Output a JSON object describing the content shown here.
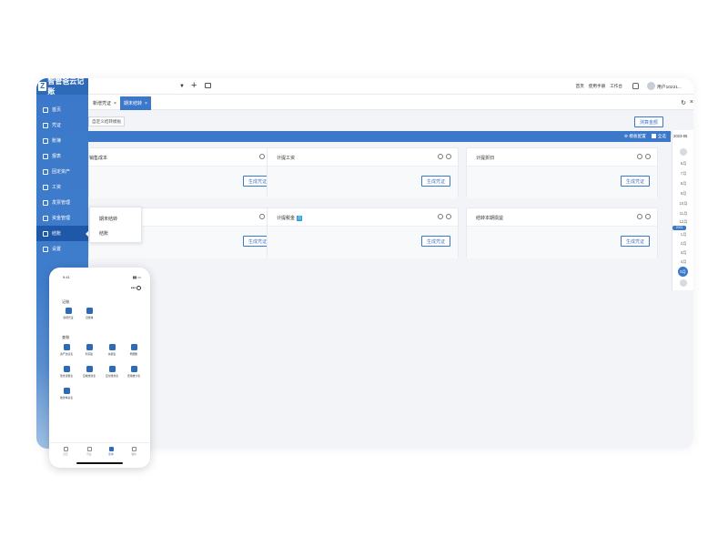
{
  "sidebar": {
    "logo_text": "智管爸云记账",
    "items": [
      {
        "label": "首页"
      },
      {
        "label": "凭证"
      },
      {
        "label": "账簿"
      },
      {
        "label": "报表"
      },
      {
        "label": "固定资产"
      },
      {
        "label": "工资"
      },
      {
        "label": "发票管理"
      },
      {
        "label": "资金管理"
      },
      {
        "label": "结账"
      },
      {
        "label": "设置"
      }
    ]
  },
  "topbar": {
    "links": [
      "首页",
      "使用手册",
      "工作台"
    ],
    "user": "用户10221..."
  },
  "tabs": [
    {
      "label": "新增凭证"
    },
    {
      "label": "期末结转"
    }
  ],
  "toolbar": {
    "custom_template": "自定义结转模板",
    "trial_button": "测算金额"
  },
  "strip": {
    "template_config": "模板配置",
    "select_all": "全选"
  },
  "cards": [
    {
      "title": "销售成本",
      "button": "生成凭证"
    },
    {
      "title": "计提工资",
      "button": "生成凭证"
    },
    {
      "title": "计提折旧",
      "button": "生成凭证"
    },
    {
      "title": "",
      "button": "生成凭证"
    },
    {
      "title": "计提税金",
      "button": "生成凭证",
      "tag": "月"
    },
    {
      "title": "结转本期损益",
      "button": "生成凭证"
    }
  ],
  "popup": [
    "期末结转",
    "结账"
  ],
  "right_panel": {
    "year": "2023-05",
    "months": [
      "6月",
      "7月",
      "8月",
      "9月",
      "10月",
      "11月",
      "12月"
    ],
    "year_badge": "2023",
    "months2": [
      "1月",
      "2月",
      "3月",
      "4月"
    ],
    "selected": "5月"
  },
  "phone": {
    "time": "9:41",
    "section1": "记账",
    "apps1": [
      {
        "label": "新增凭证"
      },
      {
        "label": "记账簿"
      }
    ],
    "section2": "查账",
    "apps2": [
      {
        "label": "资产负债表"
      },
      {
        "label": "利润表"
      },
      {
        "label": "余额表"
      },
      {
        "label": "明细账"
      },
      {
        "label": "现金流量表"
      },
      {
        "label": "应收账款表"
      },
      {
        "label": "应付账款表"
      },
      {
        "label": "费用统计表"
      },
      {
        "label": "收款单总表"
      }
    ],
    "tabs": [
      {
        "label": "首页"
      },
      {
        "label": "凭证"
      },
      {
        "label": "账簿"
      },
      {
        "label": "我的"
      }
    ]
  },
  "colors": {
    "primary": "#3b78c9",
    "sidebar_active": "#1f58a8"
  }
}
